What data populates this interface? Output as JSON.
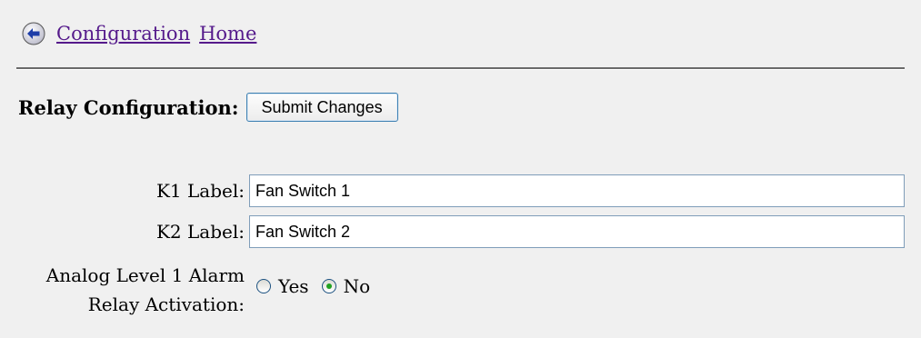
{
  "nav": {
    "back_icon": "back-arrow-icon",
    "links": [
      "Configuration",
      "Home"
    ]
  },
  "relay": {
    "title": "Relay Configuration:",
    "submit_label": "Submit Changes"
  },
  "fields": [
    {
      "label": "K1 Label:",
      "value": "Fan Switch 1"
    },
    {
      "label": "K2 Label:",
      "value": "Fan Switch 2"
    }
  ],
  "analog_alarm": {
    "label_line1": "Analog Level 1 Alarm",
    "label_line2": "Relay Activation:",
    "options": [
      {
        "label": "Yes",
        "selected": false
      },
      {
        "label": "No",
        "selected": true
      }
    ]
  },
  "colors": {
    "link": "#551a8b",
    "background": "#f0f0f0",
    "radio_selected": "#21a121"
  }
}
